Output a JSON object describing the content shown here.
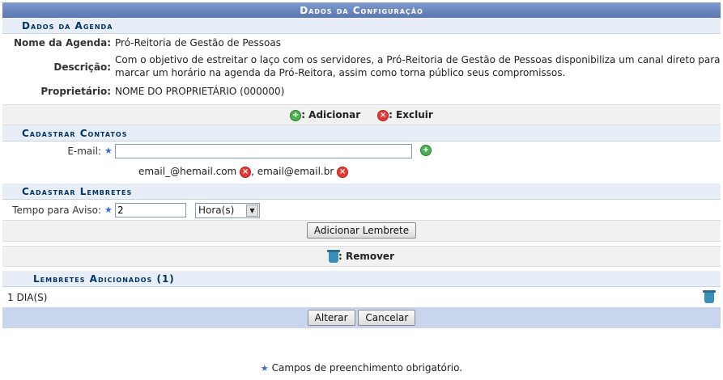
{
  "caption": "Dados da Configuração",
  "agenda": {
    "section_title": "Dados da Agenda",
    "name_label": "Nome da Agenda:",
    "name_value": "Pró-Reitoria de Gestão de Pessoas",
    "desc_label": "Descrição:",
    "desc_value_line1": "Com o objetivo de estreitar o laço com os servidores, a Pró-Reitoria de Gestão de Pessoas disponibiliza um canal direto para",
    "desc_value_line2": "marcar um horário na agenda da Pró-Reitora, assim como torna público seus compromissos.",
    "owner_label": "Proprietário:",
    "owner_value": "NOME DO PROPRIETÁRIO (000000)"
  },
  "legend1": {
    "add": ": Adicionar",
    "delete": ": Excluir"
  },
  "contacts": {
    "section_title": "Cadastrar Contatos",
    "email_label": "E-mail:",
    "email_value": "",
    "email1": "email_@hemail.com",
    "separator": ", ",
    "email2": "email@email.br"
  },
  "reminders": {
    "section_title": "Cadastrar Lembretes",
    "tempo_label": "Tempo para Aviso:",
    "tempo_value": "2",
    "unit_selected": "Hora(s)",
    "add_button": "Adicionar Lembrete"
  },
  "legend2": {
    "remove": ": Remover"
  },
  "added": {
    "section_title": "Lembretes Adicionados (1)",
    "items": [
      "1 DIA(S)"
    ]
  },
  "buttons": {
    "alterar": "Alterar",
    "cancelar": "Cancelar"
  },
  "footer_note": "Campos de preenchimento obrigatório."
}
